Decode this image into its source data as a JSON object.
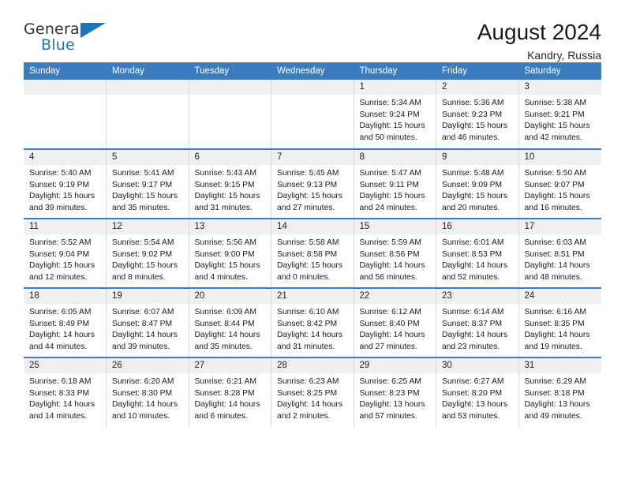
{
  "logo": {
    "word_one": "General",
    "word_two": "Blue",
    "triangle_color": "#1b75bb"
  },
  "header": {
    "title": "August 2024",
    "subtitle": "Kandry, Russia"
  },
  "colors": {
    "header_blue": "#3b7cbf",
    "daynum_band": "#f0f0f0",
    "text": "#1a1a1a"
  },
  "calendar": {
    "weekday_headers": [
      "Sunday",
      "Monday",
      "Tuesday",
      "Wednesday",
      "Thursday",
      "Friday",
      "Saturday"
    ],
    "weeks": [
      [
        {
          "day": "",
          "sunrise": "",
          "sunset": "",
          "daylight_line1": "",
          "daylight_line2": ""
        },
        {
          "day": "",
          "sunrise": "",
          "sunset": "",
          "daylight_line1": "",
          "daylight_line2": ""
        },
        {
          "day": "",
          "sunrise": "",
          "sunset": "",
          "daylight_line1": "",
          "daylight_line2": ""
        },
        {
          "day": "",
          "sunrise": "",
          "sunset": "",
          "daylight_line1": "",
          "daylight_line2": ""
        },
        {
          "day": "1",
          "sunrise": "Sunrise: 5:34 AM",
          "sunset": "Sunset: 9:24 PM",
          "daylight_line1": "Daylight: 15 hours",
          "daylight_line2": "and 50 minutes."
        },
        {
          "day": "2",
          "sunrise": "Sunrise: 5:36 AM",
          "sunset": "Sunset: 9:23 PM",
          "daylight_line1": "Daylight: 15 hours",
          "daylight_line2": "and 46 minutes."
        },
        {
          "day": "3",
          "sunrise": "Sunrise: 5:38 AM",
          "sunset": "Sunset: 9:21 PM",
          "daylight_line1": "Daylight: 15 hours",
          "daylight_line2": "and 42 minutes."
        }
      ],
      [
        {
          "day": "4",
          "sunrise": "Sunrise: 5:40 AM",
          "sunset": "Sunset: 9:19 PM",
          "daylight_line1": "Daylight: 15 hours",
          "daylight_line2": "and 39 minutes."
        },
        {
          "day": "5",
          "sunrise": "Sunrise: 5:41 AM",
          "sunset": "Sunset: 9:17 PM",
          "daylight_line1": "Daylight: 15 hours",
          "daylight_line2": "and 35 minutes."
        },
        {
          "day": "6",
          "sunrise": "Sunrise: 5:43 AM",
          "sunset": "Sunset: 9:15 PM",
          "daylight_line1": "Daylight: 15 hours",
          "daylight_line2": "and 31 minutes."
        },
        {
          "day": "7",
          "sunrise": "Sunrise: 5:45 AM",
          "sunset": "Sunset: 9:13 PM",
          "daylight_line1": "Daylight: 15 hours",
          "daylight_line2": "and 27 minutes."
        },
        {
          "day": "8",
          "sunrise": "Sunrise: 5:47 AM",
          "sunset": "Sunset: 9:11 PM",
          "daylight_line1": "Daylight: 15 hours",
          "daylight_line2": "and 24 minutes."
        },
        {
          "day": "9",
          "sunrise": "Sunrise: 5:48 AM",
          "sunset": "Sunset: 9:09 PM",
          "daylight_line1": "Daylight: 15 hours",
          "daylight_line2": "and 20 minutes."
        },
        {
          "day": "10",
          "sunrise": "Sunrise: 5:50 AM",
          "sunset": "Sunset: 9:07 PM",
          "daylight_line1": "Daylight: 15 hours",
          "daylight_line2": "and 16 minutes."
        }
      ],
      [
        {
          "day": "11",
          "sunrise": "Sunrise: 5:52 AM",
          "sunset": "Sunset: 9:04 PM",
          "daylight_line1": "Daylight: 15 hours",
          "daylight_line2": "and 12 minutes."
        },
        {
          "day": "12",
          "sunrise": "Sunrise: 5:54 AM",
          "sunset": "Sunset: 9:02 PM",
          "daylight_line1": "Daylight: 15 hours",
          "daylight_line2": "and 8 minutes."
        },
        {
          "day": "13",
          "sunrise": "Sunrise: 5:56 AM",
          "sunset": "Sunset: 9:00 PM",
          "daylight_line1": "Daylight: 15 hours",
          "daylight_line2": "and 4 minutes."
        },
        {
          "day": "14",
          "sunrise": "Sunrise: 5:58 AM",
          "sunset": "Sunset: 8:58 PM",
          "daylight_line1": "Daylight: 15 hours",
          "daylight_line2": "and 0 minutes."
        },
        {
          "day": "15",
          "sunrise": "Sunrise: 5:59 AM",
          "sunset": "Sunset: 8:56 PM",
          "daylight_line1": "Daylight: 14 hours",
          "daylight_line2": "and 56 minutes."
        },
        {
          "day": "16",
          "sunrise": "Sunrise: 6:01 AM",
          "sunset": "Sunset: 8:53 PM",
          "daylight_line1": "Daylight: 14 hours",
          "daylight_line2": "and 52 minutes."
        },
        {
          "day": "17",
          "sunrise": "Sunrise: 6:03 AM",
          "sunset": "Sunset: 8:51 PM",
          "daylight_line1": "Daylight: 14 hours",
          "daylight_line2": "and 48 minutes."
        }
      ],
      [
        {
          "day": "18",
          "sunrise": "Sunrise: 6:05 AM",
          "sunset": "Sunset: 8:49 PM",
          "daylight_line1": "Daylight: 14 hours",
          "daylight_line2": "and 44 minutes."
        },
        {
          "day": "19",
          "sunrise": "Sunrise: 6:07 AM",
          "sunset": "Sunset: 8:47 PM",
          "daylight_line1": "Daylight: 14 hours",
          "daylight_line2": "and 39 minutes."
        },
        {
          "day": "20",
          "sunrise": "Sunrise: 6:09 AM",
          "sunset": "Sunset: 8:44 PM",
          "daylight_line1": "Daylight: 14 hours",
          "daylight_line2": "and 35 minutes."
        },
        {
          "day": "21",
          "sunrise": "Sunrise: 6:10 AM",
          "sunset": "Sunset: 8:42 PM",
          "daylight_line1": "Daylight: 14 hours",
          "daylight_line2": "and 31 minutes."
        },
        {
          "day": "22",
          "sunrise": "Sunrise: 6:12 AM",
          "sunset": "Sunset: 8:40 PM",
          "daylight_line1": "Daylight: 14 hours",
          "daylight_line2": "and 27 minutes."
        },
        {
          "day": "23",
          "sunrise": "Sunrise: 6:14 AM",
          "sunset": "Sunset: 8:37 PM",
          "daylight_line1": "Daylight: 14 hours",
          "daylight_line2": "and 23 minutes."
        },
        {
          "day": "24",
          "sunrise": "Sunrise: 6:16 AM",
          "sunset": "Sunset: 8:35 PM",
          "daylight_line1": "Daylight: 14 hours",
          "daylight_line2": "and 19 minutes."
        }
      ],
      [
        {
          "day": "25",
          "sunrise": "Sunrise: 6:18 AM",
          "sunset": "Sunset: 8:33 PM",
          "daylight_line1": "Daylight: 14 hours",
          "daylight_line2": "and 14 minutes."
        },
        {
          "day": "26",
          "sunrise": "Sunrise: 6:20 AM",
          "sunset": "Sunset: 8:30 PM",
          "daylight_line1": "Daylight: 14 hours",
          "daylight_line2": "and 10 minutes."
        },
        {
          "day": "27",
          "sunrise": "Sunrise: 6:21 AM",
          "sunset": "Sunset: 8:28 PM",
          "daylight_line1": "Daylight: 14 hours",
          "daylight_line2": "and 6 minutes."
        },
        {
          "day": "28",
          "sunrise": "Sunrise: 6:23 AM",
          "sunset": "Sunset: 8:25 PM",
          "daylight_line1": "Daylight: 14 hours",
          "daylight_line2": "and 2 minutes."
        },
        {
          "day": "29",
          "sunrise": "Sunrise: 6:25 AM",
          "sunset": "Sunset: 8:23 PM",
          "daylight_line1": "Daylight: 13 hours",
          "daylight_line2": "and 57 minutes."
        },
        {
          "day": "30",
          "sunrise": "Sunrise: 6:27 AM",
          "sunset": "Sunset: 8:20 PM",
          "daylight_line1": "Daylight: 13 hours",
          "daylight_line2": "and 53 minutes."
        },
        {
          "day": "31",
          "sunrise": "Sunrise: 6:29 AM",
          "sunset": "Sunset: 8:18 PM",
          "daylight_line1": "Daylight: 13 hours",
          "daylight_line2": "and 49 minutes."
        }
      ]
    ]
  }
}
